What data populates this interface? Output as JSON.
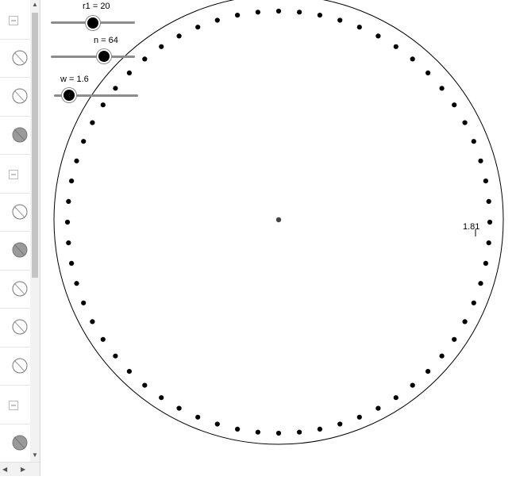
{
  "sliders": {
    "r1": {
      "label": "r1 = 20",
      "fraction": 0.45
    },
    "n": {
      "label": "n = 64",
      "fraction": 0.6
    },
    "w": {
      "label": "w = 1.6",
      "fraction": 0.15
    }
  },
  "drawing": {
    "point_count": 64,
    "measurement_label": "1.81",
    "point_color": "#000000",
    "circle_color": "#000000",
    "center_color": "#444444"
  },
  "algebra_view": {
    "items": [
      {
        "kind": "collapse",
        "icon": "collapse-icon"
      },
      {
        "kind": "hidden",
        "icon": "visibility-off-icon"
      },
      {
        "kind": "hidden",
        "icon": "visibility-off-icon"
      },
      {
        "kind": "visible",
        "icon": "visibility-on-icon"
      },
      {
        "kind": "collapse",
        "icon": "collapse-icon"
      },
      {
        "kind": "hidden",
        "icon": "visibility-off-icon"
      },
      {
        "kind": "visible",
        "icon": "visibility-on-icon"
      },
      {
        "kind": "hidden",
        "icon": "visibility-off-icon"
      },
      {
        "kind": "hidden",
        "icon": "visibility-off-icon"
      },
      {
        "kind": "hidden",
        "icon": "visibility-off-icon"
      },
      {
        "kind": "collapse",
        "icon": "collapse-icon"
      },
      {
        "kind": "visible",
        "icon": "visibility-on-icon"
      }
    ]
  }
}
